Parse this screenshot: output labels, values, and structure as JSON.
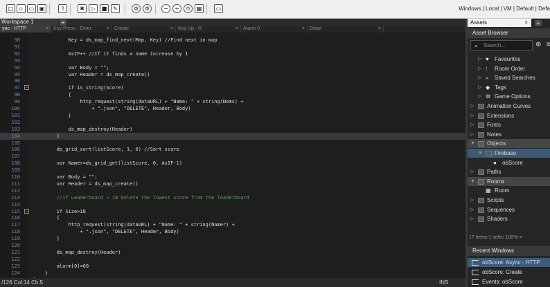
{
  "toolbar": {
    "buttons": [
      {
        "name": "new-project",
        "glyph": "□"
      },
      {
        "name": "new-file",
        "glyph": "▫"
      },
      {
        "name": "open",
        "glyph": "▭"
      },
      {
        "name": "save",
        "glyph": "▣"
      },
      {
        "name": "export",
        "glyph": "⇪"
      },
      {
        "name": "debug",
        "glyph": "✱"
      },
      {
        "name": "run",
        "glyph": "▷"
      },
      {
        "name": "stop",
        "glyph": "■"
      },
      {
        "name": "clean",
        "glyph": "✎"
      },
      {
        "name": "settings",
        "glyph": "⚙"
      },
      {
        "name": "preferences",
        "glyph": "⚙"
      },
      {
        "name": "zoom-out",
        "glyph": "−"
      },
      {
        "name": "zoom-in",
        "glyph": "+"
      },
      {
        "name": "zoom-reset",
        "glyph": "⊙"
      },
      {
        "name": "layout",
        "glyph": "▦"
      },
      {
        "name": "device",
        "glyph": "▭"
      }
    ],
    "target_info": "Windows | Local | VM | Default | Defa"
  },
  "workspace_tab": {
    "label": "Workspace 1",
    "plus": "+"
  },
  "event_tabs": [
    {
      "label": "ync - HTTP",
      "active": true
    },
    {
      "label": "Key Press - Enter",
      "active": false
    },
    {
      "label": "Create",
      "active": false
    },
    {
      "label": "Key Up - R",
      "active": false
    },
    {
      "label": "Alarm 0",
      "active": false
    },
    {
      "label": "Draw",
      "active": false
    }
  ],
  "tab_close": "×",
  "code_lines": [
    {
      "num": "90",
      "code": "            Key = ds_map_find_next(Map, Key) //Find next in map",
      "hl": false,
      "fold": ""
    },
    {
      "num": "91",
      "code": "",
      "hl": false,
      "fold": ""
    },
    {
      "num": "92",
      "code": "            AsIF++ //If it finds a name increase by 1",
      "hl": false,
      "fold": ""
    },
    {
      "num": "93",
      "code": "",
      "hl": false,
      "fold": ""
    },
    {
      "num": "94",
      "code": "            var Body = \"\";",
      "hl": false,
      "fold": ""
    },
    {
      "num": "95",
      "code": "            var Header = ds_map_create()",
      "hl": false,
      "fold": ""
    },
    {
      "num": "96",
      "code": "",
      "hl": false,
      "fold": ""
    },
    {
      "num": "97",
      "code": "            if is_string(Score)",
      "hl": false,
      "fold": "−"
    },
    {
      "num": "98",
      "code": "            {",
      "hl": false,
      "fold": ""
    },
    {
      "num": "99",
      "code": "                http_request(string(dataURL) + \"Name: \" + string(Noms) +",
      "hl": false,
      "fold": ""
    },
    {
      "num": "100",
      "code": "                    + \".json\", \"DELETE\", Header, Body)",
      "hl": false,
      "fold": ""
    },
    {
      "num": "101",
      "code": "            }",
      "hl": false,
      "fold": ""
    },
    {
      "num": "102",
      "code": "",
      "hl": false,
      "fold": ""
    },
    {
      "num": "103",
      "code": "            ds_map_destroy(Header)",
      "hl": false,
      "fold": ""
    },
    {
      "num": "104",
      "code": "        }",
      "hl": true,
      "fold": ""
    },
    {
      "num": "105",
      "code": "",
      "hl": false,
      "fold": ""
    },
    {
      "num": "106",
      "code": "        ds_grid_sort(listScore, 1, 0) //Sort score",
      "hl": false,
      "fold": ""
    },
    {
      "num": "107",
      "code": "",
      "hl": false,
      "fold": ""
    },
    {
      "num": "108",
      "code": "        var Namer=ds_grid_get(listScore, 0, AsIF-1)",
      "hl": false,
      "fold": ""
    },
    {
      "num": "109",
      "code": "",
      "hl": false,
      "fold": ""
    },
    {
      "num": "110",
      "code": "        var Body = \"\";",
      "hl": false,
      "fold": ""
    },
    {
      "num": "111",
      "code": "        var Header = ds_map_create()",
      "hl": false,
      "fold": ""
    },
    {
      "num": "112",
      "code": "",
      "hl": false,
      "fold": ""
    },
    {
      "num": "113",
      "code": "        //if Leaderboard > 18 Delete the lowest score from the leaderboard",
      "hl": false,
      "fold": ""
    },
    {
      "num": "114",
      "code": "",
      "hl": false,
      "fold": ""
    },
    {
      "num": "115",
      "code": "        if Size>18",
      "hl": false,
      "fold": "−"
    },
    {
      "num": "116",
      "code": "        {",
      "hl": false,
      "fold": ""
    },
    {
      "num": "117",
      "code": "            http_request(string(dataURL) + \"Name: \" + string(Namer) +",
      "hl": false,
      "fold": ""
    },
    {
      "num": "118",
      "code": "                + \".json\", \"DELETE\", Header, Body)",
      "hl": false,
      "fold": ""
    },
    {
      "num": "119",
      "code": "        }",
      "hl": false,
      "fold": ""
    },
    {
      "num": "120",
      "code": "",
      "hl": false,
      "fold": ""
    },
    {
      "num": "121",
      "code": "        ds_map_destroy(Header)",
      "hl": false,
      "fold": ""
    },
    {
      "num": "122",
      "code": "",
      "hl": false,
      "fold": ""
    },
    {
      "num": "123",
      "code": "        alarm[0]=60",
      "hl": false,
      "fold": ""
    },
    {
      "num": "124",
      "code": "    }",
      "hl": false,
      "fold": ""
    },
    {
      "num": "125",
      "code": "}",
      "hl": false,
      "fold": ""
    }
  ],
  "status": {
    "position": "/126 Col:14 Ch:5",
    "mode": "INS"
  },
  "assets_panel": {
    "tab_label": "Assets",
    "tab_close": "×",
    "plus": "+",
    "title": "Asset Browser",
    "search_placeholder": "Search...",
    "search_icon": "search-icon",
    "add_glyph": "⊕",
    "menu_glyph": "≡",
    "tree": [
      {
        "label": "Favourites",
        "depth": 1,
        "icon": "heart-icon",
        "glyph": "♥",
        "kind": "icon",
        "state": ""
      },
      {
        "label": "Room Order",
        "depth": 1,
        "icon": "room-order-icon",
        "glyph": "⁝",
        "kind": "icon",
        "state": ""
      },
      {
        "label": "Saved Searches",
        "depth": 1,
        "icon": "search-icon",
        "glyph": "⌕",
        "kind": "icon",
        "state": ""
      },
      {
        "label": "Tags",
        "depth": 1,
        "icon": "tag-icon",
        "glyph": "◆",
        "kind": "icon",
        "state": ""
      },
      {
        "label": "Game Options",
        "depth": 1,
        "icon": "gear-icon",
        "glyph": "⚙",
        "kind": "icon",
        "state": ""
      },
      {
        "label": "Animation Curves",
        "depth": 0,
        "icon": "folder-icon",
        "glyph": "",
        "kind": "folder",
        "state": ""
      },
      {
        "label": "Extensions",
        "depth": 0,
        "icon": "folder-icon",
        "glyph": "",
        "kind": "folder",
        "state": ""
      },
      {
        "label": "Fonts",
        "depth": 0,
        "icon": "folder-icon",
        "glyph": "",
        "kind": "folder",
        "state": ""
      },
      {
        "label": "Notes",
        "depth": 0,
        "icon": "folder-icon",
        "glyph": "",
        "kind": "folder",
        "state": ""
      },
      {
        "label": "Objects",
        "depth": 0,
        "icon": "folder-icon",
        "glyph": "",
        "kind": "folder",
        "state": "open-sel"
      },
      {
        "label": "Firebase",
        "depth": 1,
        "icon": "folder-icon",
        "glyph": "",
        "kind": "folder",
        "state": "open-active"
      },
      {
        "label": "obScore",
        "depth": 2,
        "icon": "object-icon",
        "glyph": "●",
        "kind": "icon",
        "state": "leaf"
      },
      {
        "label": "Paths",
        "depth": 0,
        "icon": "folder-icon",
        "glyph": "",
        "kind": "folder",
        "state": ""
      },
      {
        "label": "Rooms",
        "depth": 0,
        "icon": "folder-icon",
        "glyph": "",
        "kind": "folder",
        "state": "open-sel"
      },
      {
        "label": "Room",
        "depth": 1,
        "icon": "room-icon",
        "glyph": "▦",
        "kind": "icon",
        "state": "leaf"
      },
      {
        "label": "Scripts",
        "depth": 0,
        "icon": "folder-icon",
        "glyph": "",
        "kind": "folder",
        "state": ""
      },
      {
        "label": "Sequences",
        "depth": 0,
        "icon": "folder-icon",
        "glyph": "",
        "kind": "folder",
        "state": ""
      },
      {
        "label": "Shaders",
        "depth": 0,
        "icon": "folder-icon",
        "glyph": "",
        "kind": "folder",
        "state": ""
      }
    ],
    "count_text": "17 items    1 selec 100%  ≡",
    "recent_title": "Recent Windows",
    "recent_items": [
      {
        "label": "obScore: Async - HTTP",
        "active": true
      },
      {
        "label": "obScore: Create",
        "active": false
      },
      {
        "label": "Events: obScore",
        "active": false
      }
    ]
  }
}
